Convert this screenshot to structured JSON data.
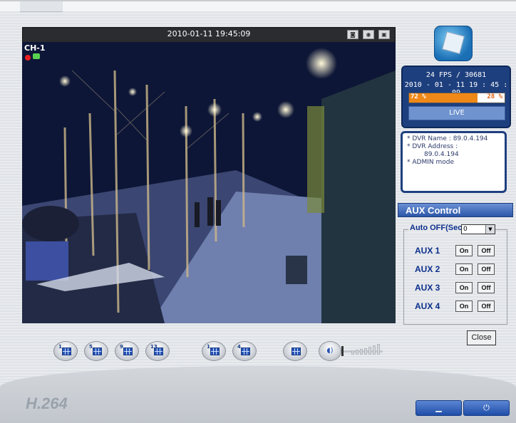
{
  "window": {
    "timestamp_bar": "2010-01-11 19:45:09",
    "brand_label": "H.264"
  },
  "video": {
    "channel_label": "CH-1",
    "toolbar_icons": [
      "snapshot-icon",
      "record-icon",
      "fullscreen-icon"
    ]
  },
  "status_panel": {
    "fps_text": "24 FPS / 30681",
    "datetime_text": "2010 - 01 - 11  19 : 45 : 09",
    "left_percent": "72 %",
    "right_percent": "28 %",
    "fill_fraction": 0.72,
    "live_label": "LIVE"
  },
  "info_panel": {
    "lines": [
      "* DVR Name : 89.0.4.194",
      "* DVR Address :",
      "89.0.4.194",
      "* ADMIN mode"
    ]
  },
  "aux_control": {
    "header": "AUX Control",
    "auto_off_label": "Auto OFF(Sec)",
    "auto_off_value": "0",
    "rows": [
      {
        "label": "AUX 1",
        "on": "On",
        "off": "Off"
      },
      {
        "label": "AUX 2",
        "on": "On",
        "off": "Off"
      },
      {
        "label": "AUX 3",
        "on": "On",
        "off": "Off"
      },
      {
        "label": "AUX 4",
        "on": "On",
        "off": "Off"
      }
    ],
    "close_label": "Close"
  },
  "bottom_controls": {
    "layout_buttons": [
      {
        "name": "layout-1-button",
        "number": "1"
      },
      {
        "name": "layout-5-button",
        "number": "5"
      },
      {
        "name": "layout-9-button",
        "number": "9"
      },
      {
        "name": "layout-13-button",
        "number": "13"
      },
      {
        "name": "layout-single-button",
        "number": "1"
      },
      {
        "name": "layout-quad-button",
        "number": "4"
      },
      {
        "name": "layout-grid-button",
        "number": ""
      }
    ],
    "speaker_icon": "speaker-icon",
    "minimize_label": "▁",
    "power_label": "⏻"
  },
  "colors": {
    "accent_blue": "#1f4ea8",
    "status_orange": "#f08818",
    "panel_navy": "#1e3f7e"
  }
}
